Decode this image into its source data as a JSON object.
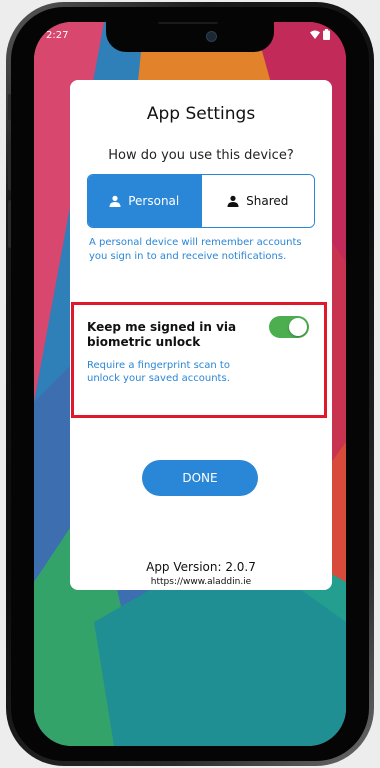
{
  "status_bar": {
    "time": "2:27",
    "icons": [
      "wifi-icon",
      "battery-icon"
    ]
  },
  "dialog": {
    "title": "App Settings",
    "question": "How do you use this device?",
    "device_modes": {
      "options": [
        {
          "label": "Personal",
          "icon": "person-icon",
          "selected": true
        },
        {
          "label": "Shared",
          "icon": "person-icon",
          "selected": false
        }
      ]
    },
    "personal_hint": "A personal device will remember accounts you sign in to and receive notifications.",
    "biometric": {
      "title": "Keep me signed in via biometric unlock",
      "description": "Require a fingerprint scan to unlock your saved accounts.",
      "enabled": true
    },
    "done_label": "DONE",
    "version": "App Version: 2.0.7",
    "url": "https://www.aladdin.ie"
  },
  "colors": {
    "accent": "#2a86d6",
    "toggle_on": "#4cae4f",
    "highlight": "#e0182c"
  }
}
